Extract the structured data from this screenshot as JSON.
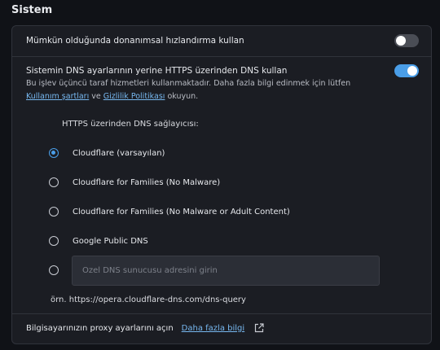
{
  "section": {
    "title": "Sistem"
  },
  "hardware_accel": {
    "label": "Mümkün olduğunda donanımsal hızlandırma kullan",
    "enabled": false
  },
  "dns_https": {
    "title": "Sistemin DNS ayarlarının yerine HTTPS üzerinden DNS kullan",
    "enabled": true,
    "desc_prefix": "Bu işlev üçüncü taraf hizmetleri kullanmaktadır. Daha fazla bilgi edinmek için lütfen",
    "terms_link": "Kullanım şartları",
    "desc_and": "ve",
    "privacy_link": "Gizlilik Politikası",
    "desc_suffix": "okuyun."
  },
  "provider": {
    "title": "HTTPS üzerinden DNS sağlayıcısı:",
    "options": [
      {
        "label": "Cloudflare (varsayılan)",
        "checked": true
      },
      {
        "label": "Cloudflare for Families (No Malware)",
        "checked": false
      },
      {
        "label": "Cloudflare for Families (No Malware or Adult Content)",
        "checked": false
      },
      {
        "label": "Google Public DNS",
        "checked": false
      }
    ],
    "custom": {
      "placeholder": "Özel DNS sunucusu adresini girin",
      "value": ""
    },
    "example": "örn. https://opera.cloudflare-dns.com/dns-query"
  },
  "proxy": {
    "label": "Bilgisayarınızın proxy ayarlarını açın",
    "link": "Daha fazla bilgi",
    "icon": "external-link-icon"
  },
  "colors": {
    "accent": "#4a9ee8",
    "link": "#77b8f0",
    "panel": "#1b1d23",
    "background": "#101217"
  }
}
